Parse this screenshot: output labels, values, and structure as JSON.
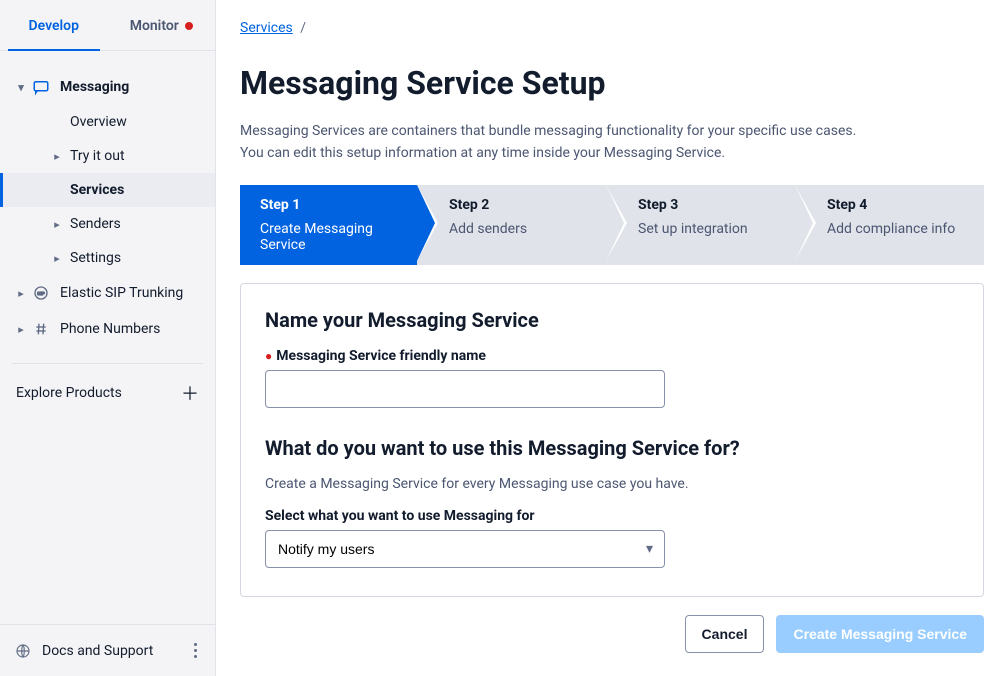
{
  "sidebar": {
    "tabs": {
      "develop": "Develop",
      "monitor": "Monitor"
    },
    "messaging": {
      "label": "Messaging",
      "overview": "Overview",
      "try": "Try it out",
      "services": "Services",
      "senders": "Senders",
      "settings": "Settings"
    },
    "sip": "Elastic SIP Trunking",
    "phone": "Phone Numbers",
    "explore": "Explore Products",
    "docs": "Docs and Support"
  },
  "breadcrumb": {
    "services": "Services",
    "sep": "/"
  },
  "page": {
    "title": "Messaging Service Setup",
    "desc1": "Messaging Services are containers that bundle messaging functionality for your specific use cases.",
    "desc2": "You can edit this setup information at any time inside your Messaging Service."
  },
  "steps": [
    {
      "label": "Step 1",
      "desc": "Create Messaging Service"
    },
    {
      "label": "Step 2",
      "desc": "Add senders"
    },
    {
      "label": "Step 3",
      "desc": "Set up integration"
    },
    {
      "label": "Step 4",
      "desc": "Add compliance info"
    }
  ],
  "form": {
    "name_heading": "Name your Messaging Service",
    "name_label": "Messaging Service friendly name",
    "name_value": "",
    "purpose_heading": "What do you want to use this Messaging Service for?",
    "purpose_helper": "Create a Messaging Service for every Messaging use case you have.",
    "purpose_label": "Select what you want to use Messaging for",
    "purpose_value": "Notify my users"
  },
  "buttons": {
    "cancel": "Cancel",
    "create": "Create Messaging Service"
  }
}
